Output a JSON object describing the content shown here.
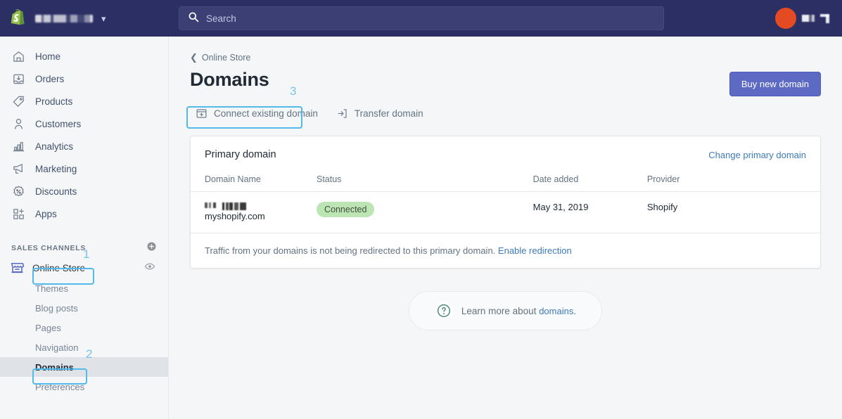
{
  "topbar": {
    "logo_icon": "shopify-bag-logo",
    "store_name": "",
    "store_chevron_icon": "chevron-down-icon",
    "search": {
      "icon": "search-icon",
      "placeholder": "Search",
      "value": ""
    },
    "avatar": {
      "icon": "avatar",
      "initial": "",
      "color": "#e44b23"
    },
    "user_name": ""
  },
  "sidebar": {
    "items": [
      {
        "label": "Home",
        "icon": "home-icon"
      },
      {
        "label": "Orders",
        "icon": "orders-icon"
      },
      {
        "label": "Products",
        "icon": "tag-icon"
      },
      {
        "label": "Customers",
        "icon": "person-icon"
      },
      {
        "label": "Analytics",
        "icon": "bar-chart-icon"
      },
      {
        "label": "Marketing",
        "icon": "megaphone-icon"
      },
      {
        "label": "Discounts",
        "icon": "discount-icon"
      },
      {
        "label": "Apps",
        "icon": "apps-grid-icon"
      }
    ],
    "section_title": "SALES CHANNELS",
    "add_channel_icon": "plus-circle-icon",
    "channel": {
      "label": "Online Store",
      "icon": "storefront-icon",
      "view_icon": "eye-icon"
    },
    "sub_items": [
      {
        "label": "Themes",
        "active": false
      },
      {
        "label": "Blog posts",
        "active": false
      },
      {
        "label": "Pages",
        "active": false
      },
      {
        "label": "Navigation",
        "active": false
      },
      {
        "label": "Domains",
        "active": true
      },
      {
        "label": "Preferences",
        "active": false
      }
    ]
  },
  "main": {
    "breadcrumb": {
      "icon": "chevron-left-icon",
      "label": "Online Store"
    },
    "page_title": "Domains",
    "buy_button": "Buy new domain",
    "actions": [
      {
        "label": "Connect existing domain",
        "icon": "window-plus-icon"
      },
      {
        "label": "Transfer domain",
        "icon": "transfer-in-icon"
      }
    ],
    "card": {
      "heading": "Primary domain",
      "change_link": "Change primary domain",
      "columns": [
        "Domain Name",
        "Status",
        "Date added",
        "Provider"
      ],
      "rows": [
        {
          "domain_suffix": "myshopify.com",
          "status": "Connected",
          "status_color": "#bbe5b3",
          "date_added": "May 31, 2019",
          "provider": "Shopify"
        }
      ],
      "footer_text": "Traffic from your domains is not being redirected to this primary domain.",
      "footer_link": "Enable redirection"
    },
    "help": {
      "icon": "question-circle-icon",
      "text": "Learn more about ",
      "link": "domains",
      "period": "."
    }
  },
  "annotations": {
    "color": "#52b9e9",
    "markers": [
      {
        "number": "1",
        "target": "sales-channels-header"
      },
      {
        "number": "2",
        "target": "sidebar-item-domains"
      },
      {
        "number": "3",
        "target": "connect-existing-domain-button"
      }
    ]
  }
}
